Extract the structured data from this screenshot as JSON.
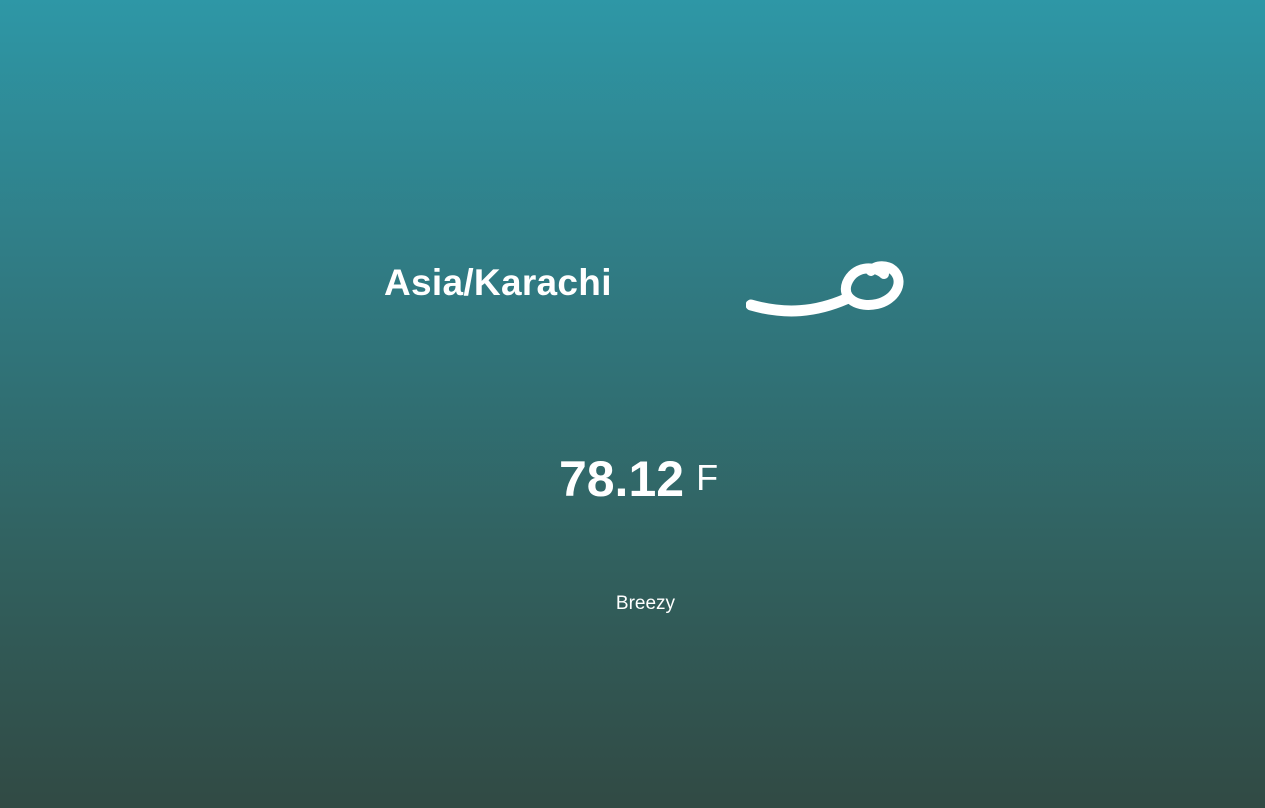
{
  "location": {
    "timezone": "Asia/Karachi",
    "icon": "wind-icon"
  },
  "temperature": {
    "value": "78.12",
    "unit": "F"
  },
  "summary": "Breezy",
  "colors": {
    "gradient_top": "#2e97a6",
    "gradient_bottom": "#314a44",
    "text": "#ffffff"
  }
}
